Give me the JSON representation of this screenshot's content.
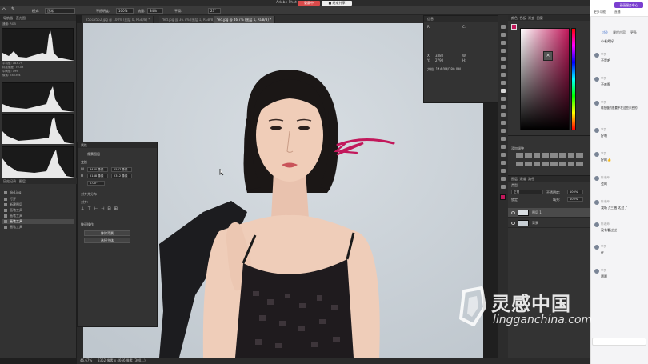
{
  "app": {
    "title": "Adobe Phot",
    "recording_label": "录屏中",
    "share_label": "■ 结束共享"
  },
  "options_bar": {
    "mode_label": "模式:",
    "mode_value": "正常",
    "opacity_label": "不透明度:",
    "opacity_value": "100%",
    "flow_label": "流量:",
    "flow_value": "84%",
    "smooth_label": "平滑:",
    "angle_value": "23°"
  },
  "doc_tabs": [
    {
      "label": "25618552.jpg @ 100% (图层 0, RGB/8) *",
      "active": false
    },
    {
      "label": "Yed.jpg @ 36.7% (图层 1, RGB/8) *",
      "active": false
    },
    {
      "label": "Yed.jpg @ 46.7% (图层 1, RGB/8) *",
      "active": true
    }
  ],
  "histogram": {
    "tabs": [
      "导航器",
      "直方图"
    ],
    "channel_label": "通道: RGB",
    "stats": [
      "平均值: 183.79",
      "标准偏差: 70.03",
      "中间值: 199",
      "像素: 785304"
    ]
  },
  "history": {
    "tabs": [
      "历史记录",
      "图层"
    ],
    "doc_label": "Yed.jpg",
    "items": [
      "打开",
      "新建图层",
      "画笔工具",
      "画笔工具",
      "画笔工具",
      "画笔工具"
    ],
    "selected_index": 4
  },
  "properties": {
    "title": "属性",
    "section_layer": "像素图层",
    "section_transform": "变换",
    "width_label": "W",
    "width_value": "3440 像素",
    "x_value": "2547 像素",
    "height_label": "H",
    "height_value": "5148 像素",
    "y_value": "2312 像素",
    "angle_value": "0.00°",
    "section_align": "对齐并分布",
    "align_label": "对齐:",
    "section_quick": "快速操作",
    "btn_remove_bg": "移除背景",
    "btn_select_subject": "选择主体"
  },
  "info": {
    "title": "信息",
    "r_label": "R:",
    "c_label": "C:",
    "x_label": "X:",
    "x_value": "3380",
    "y_label": "Y:",
    "y_value": "2790",
    "w_label": "W:",
    "h_label": "H:",
    "doc_size": "文档: 144.0M/180.0M"
  },
  "color_panel": {
    "tabs": [
      "颜色",
      "色板",
      "渐变",
      "图案"
    ],
    "fg_color": "#c2185b",
    "bg_color": "#ffffff"
  },
  "adjustments": {
    "title": "添加调整"
  },
  "layers": {
    "tabs": [
      "图层",
      "通道",
      "路径"
    ],
    "kind_label": "类型",
    "blend_mode": "正常",
    "opacity_label": "不透明度:",
    "opacity_value": "100%",
    "lock_label": "锁定:",
    "fill_label": "填充:",
    "fill_value": "100%",
    "rows": [
      {
        "name": "图层 1",
        "selected": true
      },
      {
        "name": "背景",
        "selected": false
      }
    ]
  },
  "status": {
    "zoom": "46.67%",
    "doc_info": "3352 像素 x 4666 像素 (300...)"
  },
  "chat": {
    "badge": "画画服务中心",
    "top_items": [
      "更多功能",
      "直播"
    ],
    "tabs": [
      "讨论",
      "课程内容",
      "更多"
    ],
    "active_tab": "讨论",
    "first_line": "小老师好",
    "messages": [
      {
        "name": "学员",
        "text": "不是吧"
      },
      {
        "name": "学员",
        "text": "不难啊"
      },
      {
        "name": "学员",
        "text": "现在做的是要不在这些东西的"
      },
      {
        "name": "学员",
        "text": "好啊"
      },
      {
        "name": "学员",
        "text": "好的👍"
      },
      {
        "name": "陈老师",
        "text": "会的"
      },
      {
        "name": "陈老师",
        "text": "我听了三遍 太过了"
      },
      {
        "name": "陈老师",
        "text": "没有看过过"
      },
      {
        "name": "学员",
        "text": "在"
      },
      {
        "name": "学员",
        "text": "嗯嗯"
      }
    ]
  },
  "watermark": {
    "main": "灵感中国",
    "url": "lingganchina.com"
  }
}
